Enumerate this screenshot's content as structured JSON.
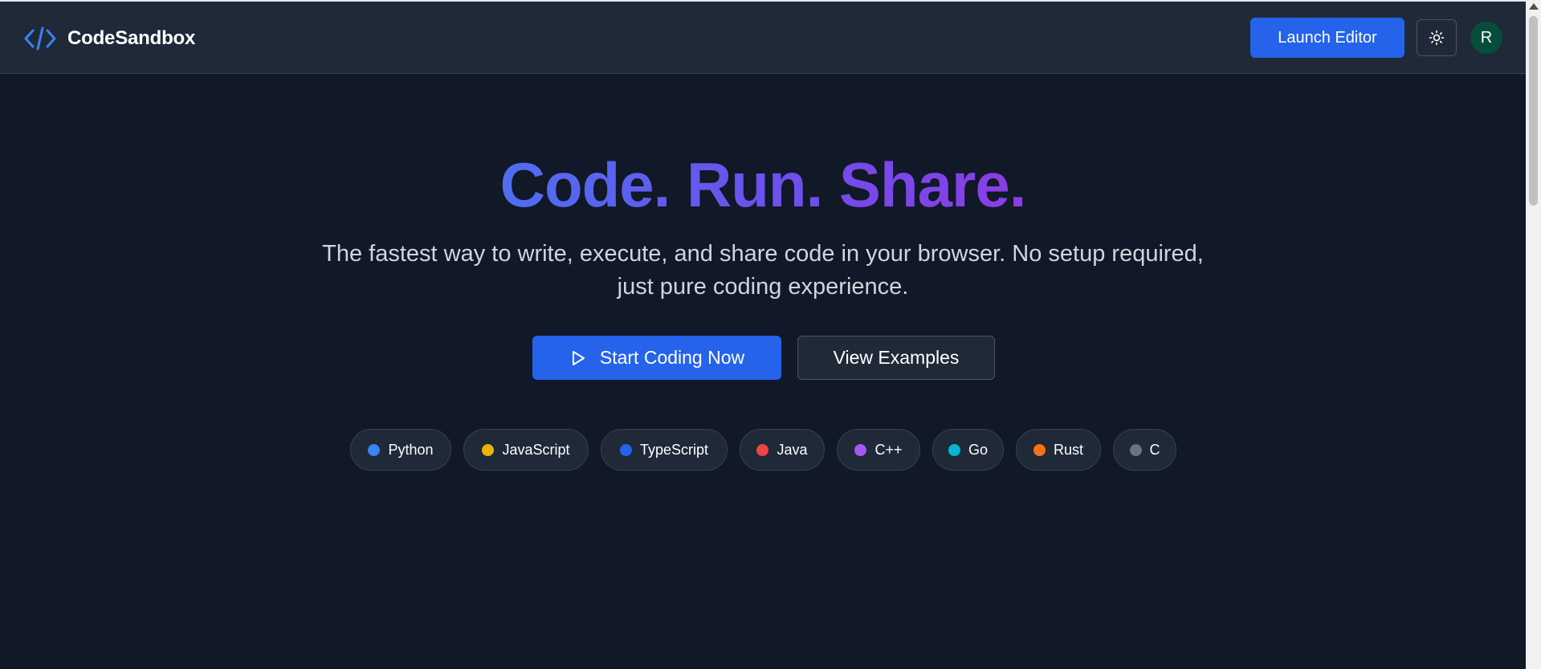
{
  "header": {
    "brand_icon": "code-brackets-icon",
    "brand_name": "CodeSandbox",
    "launch_label": "Launch Editor",
    "theme_icon": "sun-icon",
    "avatar_initial": "R"
  },
  "hero": {
    "title": "Code. Run. Share.",
    "subtitle": "The fastest way to write, execute, and share code in your browser. No setup required, just pure coding experience.",
    "primary_cta": "Start Coding Now",
    "primary_icon": "play-icon",
    "secondary_cta": "View Examples"
  },
  "languages": [
    {
      "name": "Python",
      "color": "#3b82f6"
    },
    {
      "name": "JavaScript",
      "color": "#eab308"
    },
    {
      "name": "TypeScript",
      "color": "#2563eb"
    },
    {
      "name": "Java",
      "color": "#ef4444"
    },
    {
      "name": "C++",
      "color": "#a855f7"
    },
    {
      "name": "Go",
      "color": "#06b6d4"
    },
    {
      "name": "Rust",
      "color": "#f97316"
    },
    {
      "name": "C",
      "color": "#6b7280"
    }
  ],
  "colors": {
    "accent": "#2563eb",
    "background": "#111827",
    "header_bg": "#1f2937",
    "avatar_bg": "#064e3b",
    "title_gradient": [
      "#4f6ef2",
      "#8b3ce6"
    ]
  }
}
